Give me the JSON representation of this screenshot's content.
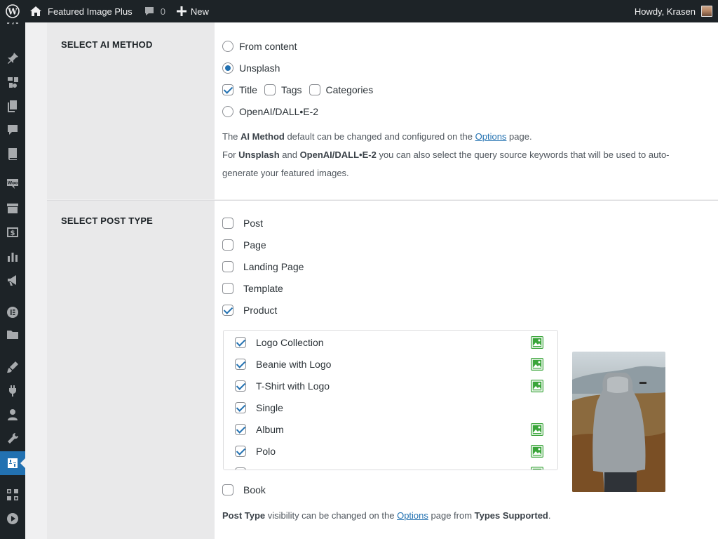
{
  "adminbar": {
    "site_name": "Featured Image Plus",
    "comments_count": "0",
    "new_label": "New",
    "howdy": "Howdy, Krasen"
  },
  "ai_method": {
    "section_title": "SELECT AI METHOD",
    "options": [
      {
        "label": "From content",
        "checked": false
      },
      {
        "label": "Unsplash",
        "checked": true
      },
      {
        "label": "OpenAI/DALL•E-2",
        "checked": false
      }
    ],
    "keywords": [
      {
        "label": "Title",
        "checked": true
      },
      {
        "label": "Tags",
        "checked": false
      },
      {
        "label": "Categories",
        "checked": false
      }
    ],
    "desc1_pre": "The ",
    "desc1_bold": "AI Method",
    "desc1_mid": " default can be changed and configured on the ",
    "desc1_link": "Options",
    "desc1_post": " page.",
    "desc2_pre": "For ",
    "desc2_bold1": "Unsplash",
    "desc2_mid": " and ",
    "desc2_bold2": "OpenAI/DALL•E-2",
    "desc2_post": " you can also select the query source keywords that will be used to auto-",
    "desc3": "generate your featured images."
  },
  "post_type": {
    "section_title": "SELECT POST TYPE",
    "types": [
      {
        "label": "Post",
        "checked": false
      },
      {
        "label": "Page",
        "checked": false
      },
      {
        "label": "Landing Page",
        "checked": false
      },
      {
        "label": "Template",
        "checked": false
      },
      {
        "label": "Product",
        "checked": true
      }
    ],
    "products": [
      {
        "label": "Logo Collection",
        "checked": true,
        "has_image": true
      },
      {
        "label": "Beanie with Logo",
        "checked": true,
        "has_image": true
      },
      {
        "label": "T-Shirt with Logo",
        "checked": true,
        "has_image": true
      },
      {
        "label": "Single",
        "checked": true,
        "has_image": false
      },
      {
        "label": "Album",
        "checked": true,
        "has_image": true
      },
      {
        "label": "Polo",
        "checked": true,
        "has_image": true
      }
    ],
    "book": {
      "label": "Book",
      "checked": false
    },
    "footer_bold1": "Post Type",
    "footer_mid": " visibility can be changed on the ",
    "footer_link": "Options",
    "footer_mid2": " page from ",
    "footer_bold2": "Types Supported",
    "footer_post": "."
  },
  "colors": {
    "accent": "#2271b1",
    "adminbar": "#1d2327",
    "image_icon": "#3aa53a"
  }
}
